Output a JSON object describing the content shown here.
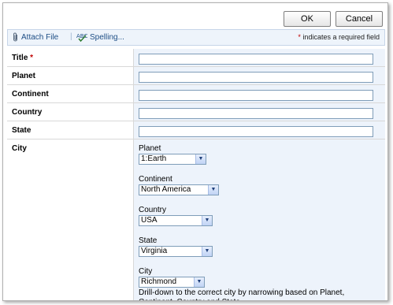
{
  "actions": {
    "ok_label": "OK",
    "cancel_label": "Cancel"
  },
  "toolbar": {
    "attach_label": "Attach File",
    "spelling_label": "Spelling...",
    "required_star": "*",
    "required_note": "indicates a required field"
  },
  "fields": {
    "title": {
      "label": "Title",
      "required_star": "*",
      "value": ""
    },
    "planet": {
      "label": "Planet",
      "value": ""
    },
    "continent": {
      "label": "Continent",
      "value": ""
    },
    "country": {
      "label": "Country",
      "value": ""
    },
    "state": {
      "label": "State",
      "value": ""
    },
    "city": {
      "label": "City"
    }
  },
  "cascade": {
    "planet": {
      "label": "Planet",
      "selected": "1:Earth"
    },
    "continent": {
      "label": "Continent",
      "selected": "North America"
    },
    "country": {
      "label": "Country",
      "selected": "USA"
    },
    "state": {
      "label": "State",
      "selected": "Virginia"
    },
    "city": {
      "label": "City",
      "selected": "Richmond"
    },
    "help_text": "Drill-down to the correct city by narrowing based on Planet, Continent, Country and State."
  }
}
